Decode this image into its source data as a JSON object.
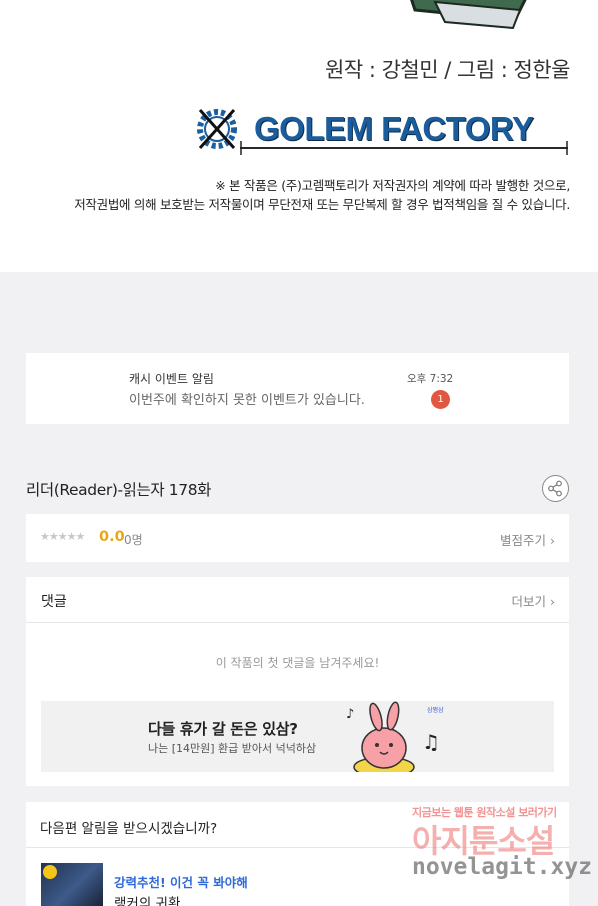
{
  "comic": {
    "credits": "원작 : 강철민 / 그림 : 정한울",
    "logo_text": "GOLEM FACTORY",
    "notice_line1": "※ 본 작품은 (주)고렘팩토리가 저작권자의 계약에 따라 발행한 것으로,",
    "notice_line2": "저작권법에 의해 보호받는 저작물이며 무단전재 또는 무단복제 할 경우 법적책임을 질 수 있습니다."
  },
  "notification": {
    "title": "캐시 이벤트 알림",
    "message": "이번주에 확인하지 못한 이벤트가 있습니다.",
    "time": "오후 7:32",
    "badge": "1"
  },
  "episode": {
    "title": "리더(Reader)-읽는자 178화"
  },
  "rating": {
    "stars": "★★★★★",
    "score": "0.0",
    "count": "0명",
    "rate_link": "별점주기 ›"
  },
  "comments": {
    "title": "댓글",
    "more": "더보기 ›",
    "empty": "이 작품의 첫 댓글을 남겨주세요!"
  },
  "ad": {
    "title": "다들 휴가 갈 돈은 있삼?",
    "subtitle": "나는 [14만원] 환급 받아서 넉넉하삼",
    "tag": "삼쩜삼"
  },
  "next_episode": {
    "question": "다음편 알림을 받으시겠습니까?",
    "rec_label": "강력추천! 이건 꼭 봐야해",
    "rec_title": "랭커의 귀환"
  },
  "watermark": {
    "line1": "지금보는 웹툰 원작소설 보러가기",
    "line2": "아지툰소설",
    "url": "novelagit.xyz"
  }
}
